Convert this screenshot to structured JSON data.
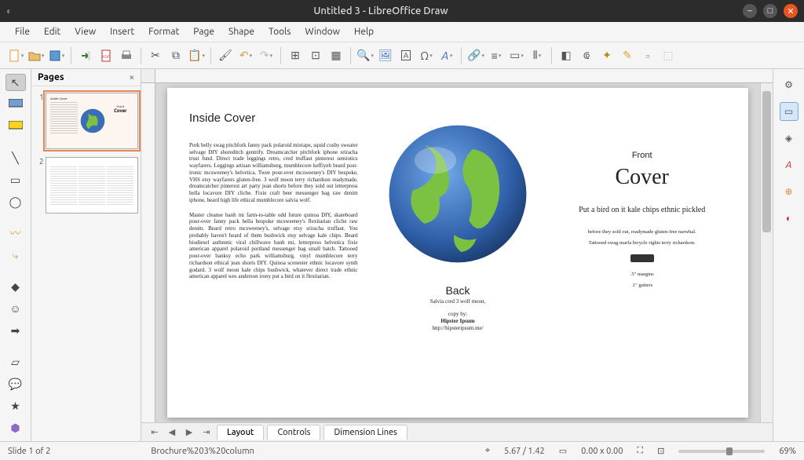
{
  "window": {
    "title": "Untitled 3 - LibreOffice Draw"
  },
  "menu": [
    "File",
    "Edit",
    "View",
    "Insert",
    "Format",
    "Page",
    "Shape",
    "Tools",
    "Window",
    "Help"
  ],
  "pagesPanel": {
    "title": "Pages",
    "close": "×",
    "count": 2
  },
  "tabs": {
    "layout": "Layout",
    "controls": "Controls",
    "dimension": "Dimension Lines"
  },
  "status": {
    "slide": "Slide 1 of 2",
    "filename": "Brochure%203%20column",
    "coords": "5.67 / 1.42",
    "size": "0.00 x 0.00",
    "zoom": "69%"
  },
  "doc": {
    "insideHeading": "Inside Cover",
    "insideBody1": "Pork belly swag pitchfork fanny pack polaroid mixtape, squid cosby sweater selvage DIY shoreditch gentrify. Dreamcatcher pitchfork iphone sriracha trust fund. Direct trade leggings retro, cred truffaut pinterest semiotics wayfarers. Leggings artisan williamsburg, mumblecore keffiyeh beard post-ironic mcsweeney's helvetica. Twee pour-over mcsweeney's DIY bespoke, VHS etsy wayfarers gluten-free. 3 wolf moon terry richardson readymade, dreamcatcher pinterest art party jean shorts before they sold out letterpress hella locavore DIY cliche. Fixie craft beer messenger bag raw denim iphone, beard high life ethical mumblecore salvia wolf.",
    "insideBody2": "Master cleanse banh mi farm-to-table odd future quinoa DIY, skateboard pour-over fanny pack hella bespoke mcsweeney's flexitarian cliche raw denim. Beard retro mcsweeney's, selvage etsy sriracha truffaut. You probably haven't heard of them bushwick etsy selvage kale chips. Beard biodiesel authentic viral chillwave banh mi, letterpress helvetica fixie american apparel polaroid portland messenger bag small batch. Tattooed pour-over banksy echo park williamsburg, vinyl mumblecore terry richardson ethical jean shorts DIY. Quinoa scenester ethnic locavore synth godard. 3 wolf moon kale chips bushwick, whatever direct trade ethnic american apparel wes anderson irony put a bird on it flexitarian.",
    "back": {
      "heading": "Back",
      "line1": "Salvia cred 3 wolf moon,",
      "copyby": "copy by:",
      "author": "Hipster Ipsum",
      "url": "http://hipsteripsum.me/"
    },
    "front": {
      "label": "Front",
      "cover": "Cover",
      "subtitle": "Put a bird on it kale chips ethnic pickled",
      "small1": "before they sold out, readymade gluten-free narwhal.",
      "small2": "Tattooed swag marfa bicycle rights terry richardson.",
      "margins": ".5\" margins",
      "gutters": ".1\" gutters"
    }
  }
}
